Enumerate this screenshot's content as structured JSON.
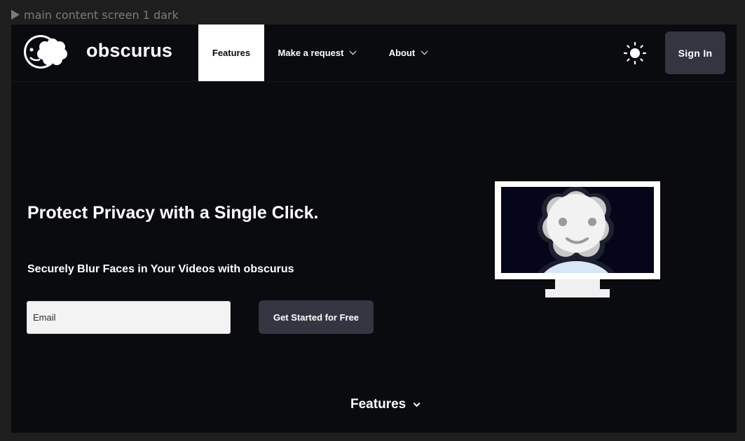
{
  "frame": {
    "label": "main content screen 1 dark"
  },
  "nav": {
    "brand": "obscurus",
    "items": [
      {
        "label": "Features",
        "active": true
      },
      {
        "label": "Make a request",
        "dropdown": true
      },
      {
        "label": "About",
        "dropdown": true
      }
    ],
    "theme_icon": "sun-icon",
    "sign_in": "Sign In"
  },
  "hero": {
    "title": "Protect Privacy with a Single Click.",
    "subtitle": "Securely Blur Faces in Your Videos with obscurus",
    "email_placeholder": "Email",
    "cta": "Get Started for Free",
    "illustration_icon": "monitor-blurred-face-icon"
  },
  "features_link": {
    "label": "Features"
  },
  "colors": {
    "background": "#0a0b0f",
    "frame": "#1e1e1e",
    "button": "#343541",
    "text": "#ffffff",
    "active_tab": "#ffffff"
  }
}
